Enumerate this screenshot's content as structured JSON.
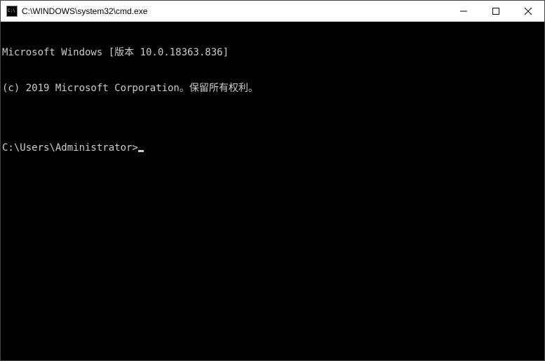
{
  "titlebar": {
    "title": "C:\\WINDOWS\\system32\\cmd.exe"
  },
  "terminal": {
    "line1": "Microsoft Windows [版本 10.0.18363.836]",
    "line2": "(c) 2019 Microsoft Corporation。保留所有权利。",
    "blank": "",
    "prompt": "C:\\Users\\Administrator>"
  }
}
